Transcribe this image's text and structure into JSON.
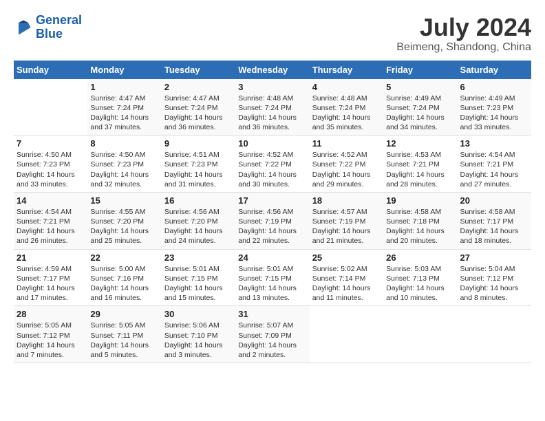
{
  "header": {
    "logo_line1": "General",
    "logo_line2": "Blue",
    "main_title": "July 2024",
    "subtitle": "Beimeng, Shandong, China"
  },
  "weekdays": [
    "Sunday",
    "Monday",
    "Tuesday",
    "Wednesday",
    "Thursday",
    "Friday",
    "Saturday"
  ],
  "weeks": [
    [
      {
        "day": "",
        "sunrise": "",
        "sunset": "",
        "daylight": ""
      },
      {
        "day": "1",
        "sunrise": "Sunrise: 4:47 AM",
        "sunset": "Sunset: 7:24 PM",
        "daylight": "Daylight: 14 hours and 37 minutes."
      },
      {
        "day": "2",
        "sunrise": "Sunrise: 4:47 AM",
        "sunset": "Sunset: 7:24 PM",
        "daylight": "Daylight: 14 hours and 36 minutes."
      },
      {
        "day": "3",
        "sunrise": "Sunrise: 4:48 AM",
        "sunset": "Sunset: 7:24 PM",
        "daylight": "Daylight: 14 hours and 36 minutes."
      },
      {
        "day": "4",
        "sunrise": "Sunrise: 4:48 AM",
        "sunset": "Sunset: 7:24 PM",
        "daylight": "Daylight: 14 hours and 35 minutes."
      },
      {
        "day": "5",
        "sunrise": "Sunrise: 4:49 AM",
        "sunset": "Sunset: 7:24 PM",
        "daylight": "Daylight: 14 hours and 34 minutes."
      },
      {
        "day": "6",
        "sunrise": "Sunrise: 4:49 AM",
        "sunset": "Sunset: 7:23 PM",
        "daylight": "Daylight: 14 hours and 33 minutes."
      }
    ],
    [
      {
        "day": "7",
        "sunrise": "Sunrise: 4:50 AM",
        "sunset": "Sunset: 7:23 PM",
        "daylight": "Daylight: 14 hours and 33 minutes."
      },
      {
        "day": "8",
        "sunrise": "Sunrise: 4:50 AM",
        "sunset": "Sunset: 7:23 PM",
        "daylight": "Daylight: 14 hours and 32 minutes."
      },
      {
        "day": "9",
        "sunrise": "Sunrise: 4:51 AM",
        "sunset": "Sunset: 7:23 PM",
        "daylight": "Daylight: 14 hours and 31 minutes."
      },
      {
        "day": "10",
        "sunrise": "Sunrise: 4:52 AM",
        "sunset": "Sunset: 7:22 PM",
        "daylight": "Daylight: 14 hours and 30 minutes."
      },
      {
        "day": "11",
        "sunrise": "Sunrise: 4:52 AM",
        "sunset": "Sunset: 7:22 PM",
        "daylight": "Daylight: 14 hours and 29 minutes."
      },
      {
        "day": "12",
        "sunrise": "Sunrise: 4:53 AM",
        "sunset": "Sunset: 7:21 PM",
        "daylight": "Daylight: 14 hours and 28 minutes."
      },
      {
        "day": "13",
        "sunrise": "Sunrise: 4:54 AM",
        "sunset": "Sunset: 7:21 PM",
        "daylight": "Daylight: 14 hours and 27 minutes."
      }
    ],
    [
      {
        "day": "14",
        "sunrise": "Sunrise: 4:54 AM",
        "sunset": "Sunset: 7:21 PM",
        "daylight": "Daylight: 14 hours and 26 minutes."
      },
      {
        "day": "15",
        "sunrise": "Sunrise: 4:55 AM",
        "sunset": "Sunset: 7:20 PM",
        "daylight": "Daylight: 14 hours and 25 minutes."
      },
      {
        "day": "16",
        "sunrise": "Sunrise: 4:56 AM",
        "sunset": "Sunset: 7:20 PM",
        "daylight": "Daylight: 14 hours and 24 minutes."
      },
      {
        "day": "17",
        "sunrise": "Sunrise: 4:56 AM",
        "sunset": "Sunset: 7:19 PM",
        "daylight": "Daylight: 14 hours and 22 minutes."
      },
      {
        "day": "18",
        "sunrise": "Sunrise: 4:57 AM",
        "sunset": "Sunset: 7:19 PM",
        "daylight": "Daylight: 14 hours and 21 minutes."
      },
      {
        "day": "19",
        "sunrise": "Sunrise: 4:58 AM",
        "sunset": "Sunset: 7:18 PM",
        "daylight": "Daylight: 14 hours and 20 minutes."
      },
      {
        "day": "20",
        "sunrise": "Sunrise: 4:58 AM",
        "sunset": "Sunset: 7:17 PM",
        "daylight": "Daylight: 14 hours and 18 minutes."
      }
    ],
    [
      {
        "day": "21",
        "sunrise": "Sunrise: 4:59 AM",
        "sunset": "Sunset: 7:17 PM",
        "daylight": "Daylight: 14 hours and 17 minutes."
      },
      {
        "day": "22",
        "sunrise": "Sunrise: 5:00 AM",
        "sunset": "Sunset: 7:16 PM",
        "daylight": "Daylight: 14 hours and 16 minutes."
      },
      {
        "day": "23",
        "sunrise": "Sunrise: 5:01 AM",
        "sunset": "Sunset: 7:15 PM",
        "daylight": "Daylight: 14 hours and 15 minutes."
      },
      {
        "day": "24",
        "sunrise": "Sunrise: 5:01 AM",
        "sunset": "Sunset: 7:15 PM",
        "daylight": "Daylight: 14 hours and 13 minutes."
      },
      {
        "day": "25",
        "sunrise": "Sunrise: 5:02 AM",
        "sunset": "Sunset: 7:14 PM",
        "daylight": "Daylight: 14 hours and 11 minutes."
      },
      {
        "day": "26",
        "sunrise": "Sunrise: 5:03 AM",
        "sunset": "Sunset: 7:13 PM",
        "daylight": "Daylight: 14 hours and 10 minutes."
      },
      {
        "day": "27",
        "sunrise": "Sunrise: 5:04 AM",
        "sunset": "Sunset: 7:12 PM",
        "daylight": "Daylight: 14 hours and 8 minutes."
      }
    ],
    [
      {
        "day": "28",
        "sunrise": "Sunrise: 5:05 AM",
        "sunset": "Sunset: 7:12 PM",
        "daylight": "Daylight: 14 hours and 7 minutes."
      },
      {
        "day": "29",
        "sunrise": "Sunrise: 5:05 AM",
        "sunset": "Sunset: 7:11 PM",
        "daylight": "Daylight: 14 hours and 5 minutes."
      },
      {
        "day": "30",
        "sunrise": "Sunrise: 5:06 AM",
        "sunset": "Sunset: 7:10 PM",
        "daylight": "Daylight: 14 hours and 3 minutes."
      },
      {
        "day": "31",
        "sunrise": "Sunrise: 5:07 AM",
        "sunset": "Sunset: 7:09 PM",
        "daylight": "Daylight: 14 hours and 2 minutes."
      },
      {
        "day": "",
        "sunrise": "",
        "sunset": "",
        "daylight": ""
      },
      {
        "day": "",
        "sunrise": "",
        "sunset": "",
        "daylight": ""
      },
      {
        "day": "",
        "sunrise": "",
        "sunset": "",
        "daylight": ""
      }
    ]
  ]
}
